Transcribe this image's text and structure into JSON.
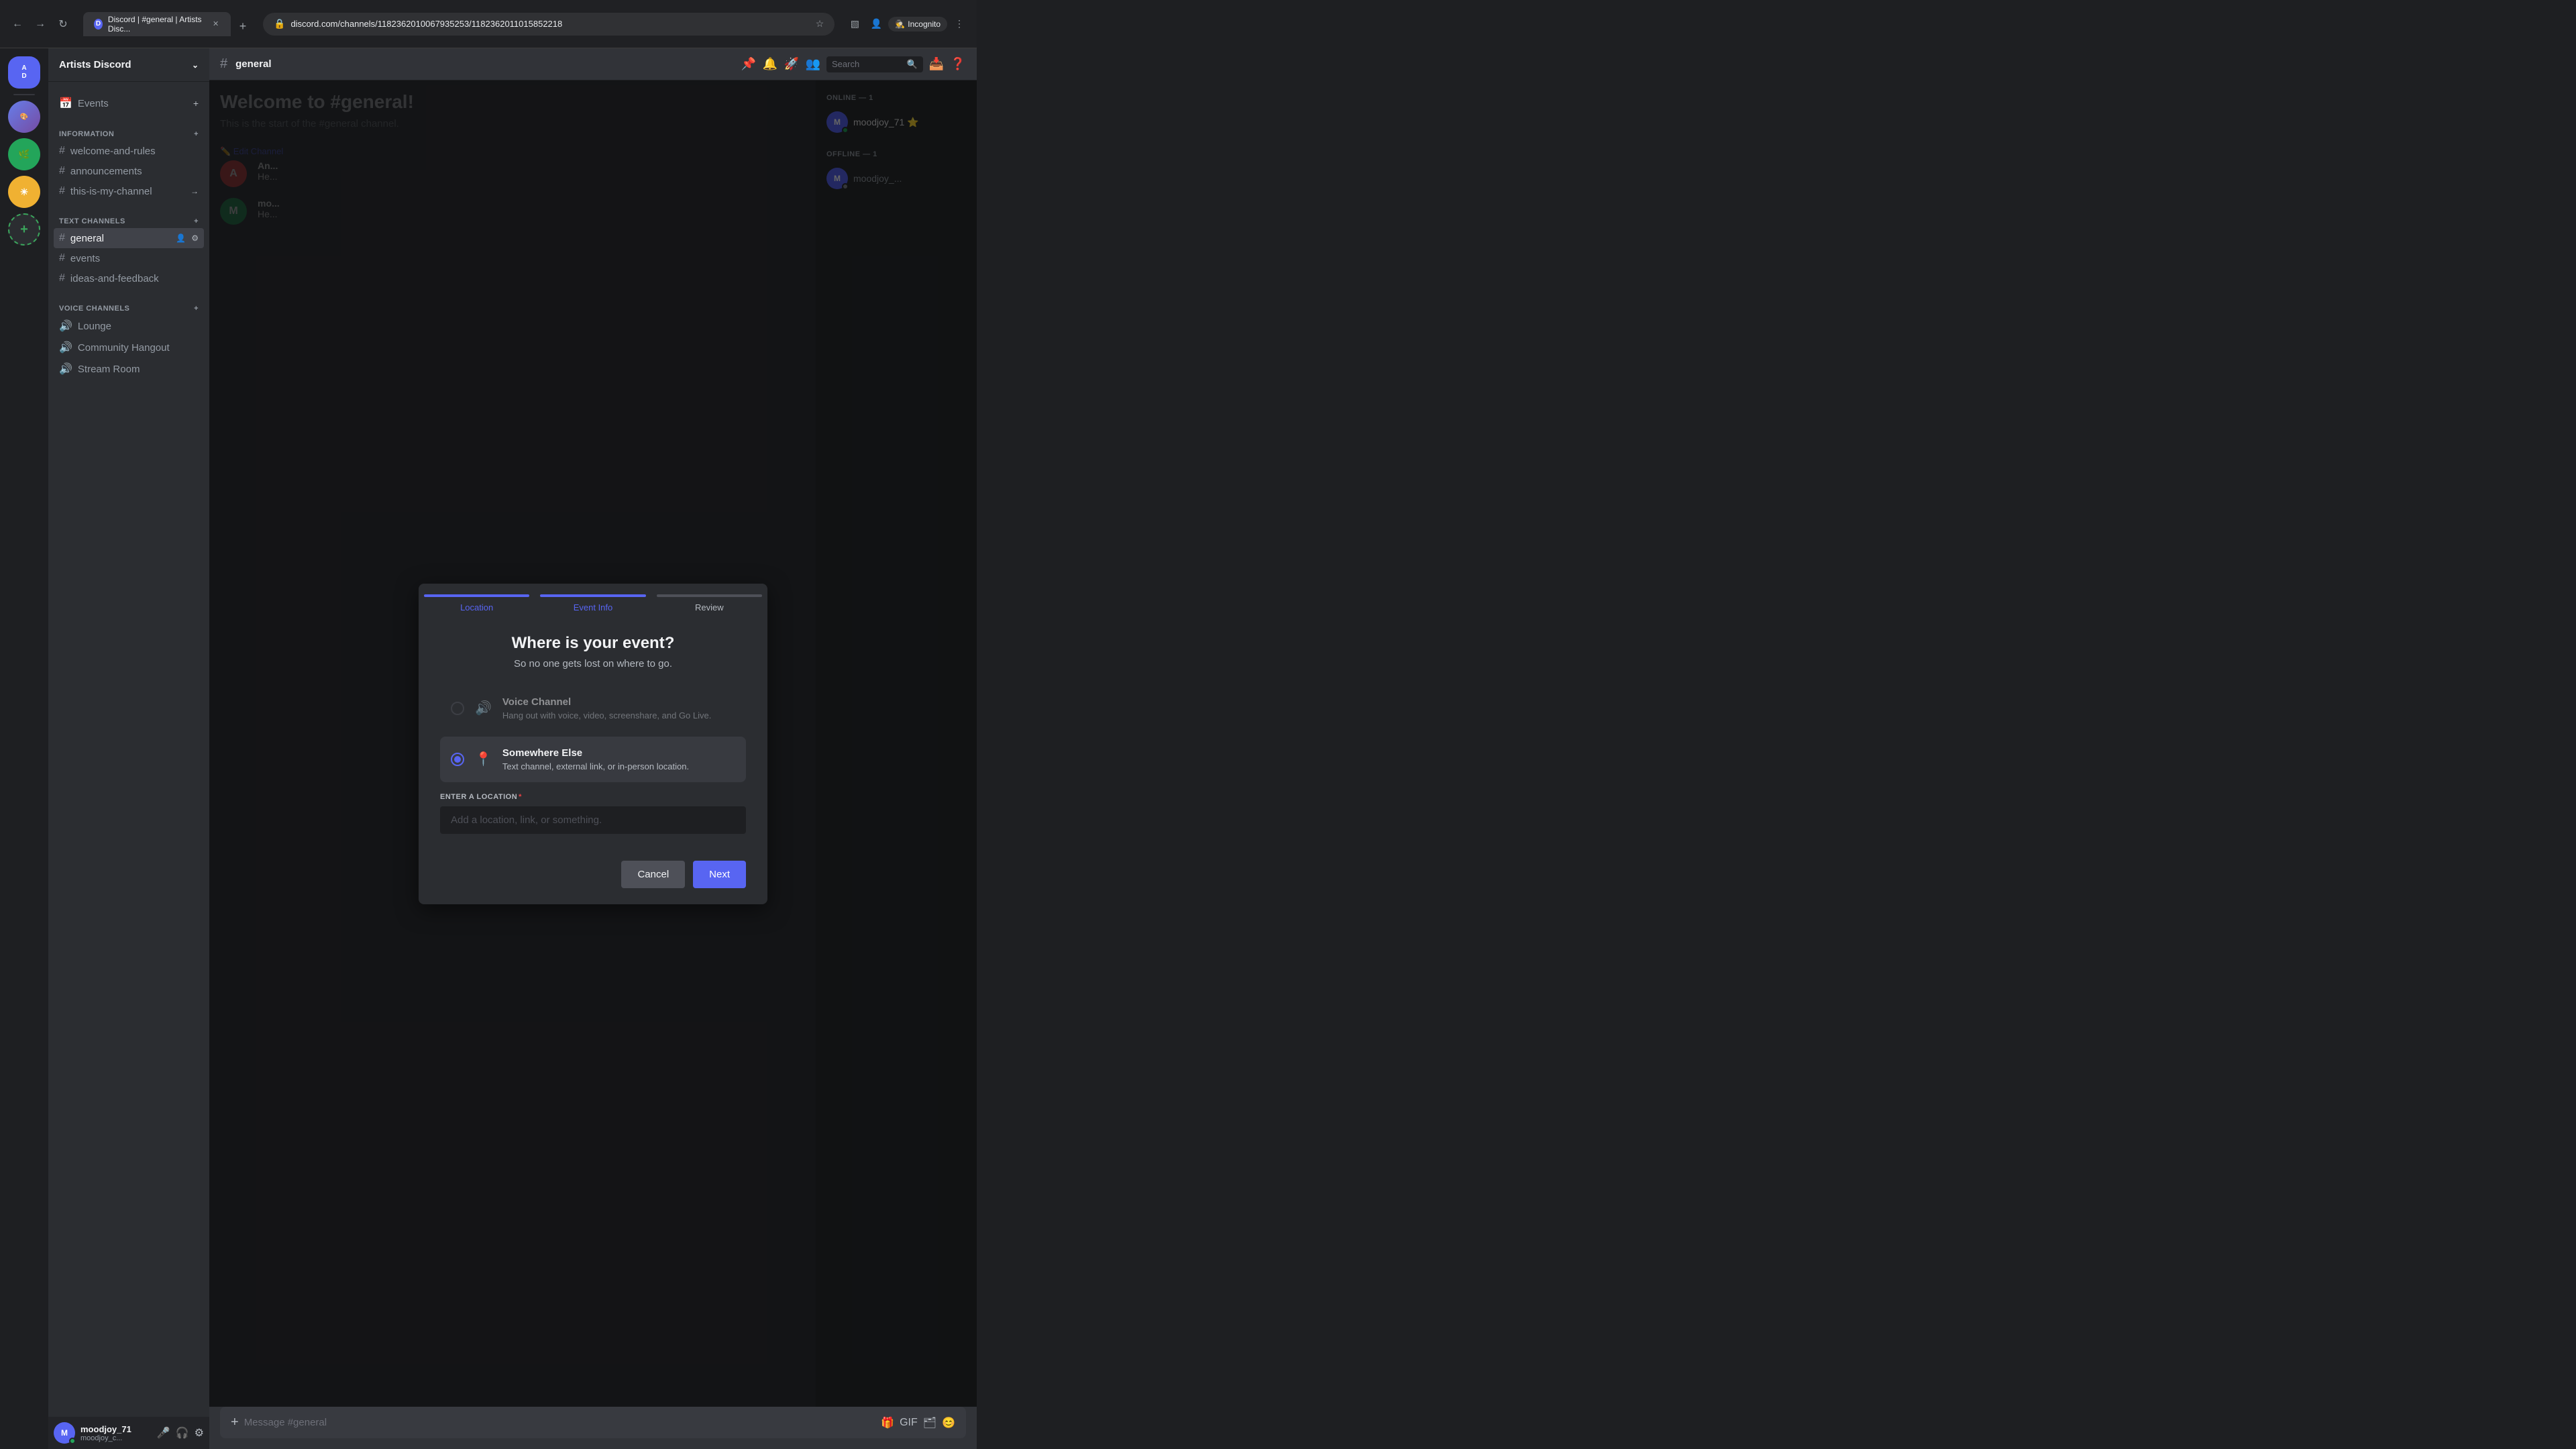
{
  "browser": {
    "tab_title": "Discord | #general | Artists Disc...",
    "tab_favicon": "D",
    "url": "discord.com/channels/1182362010067935253/1182362011015852218",
    "incognito_label": "Incognito"
  },
  "discord": {
    "server_name": "Artists Discord",
    "channel_name": "general",
    "search_placeholder": "Search"
  },
  "sidebar": {
    "information_section": "INFORMATION",
    "text_channels_section": "TEXT CHANNELS",
    "voice_channels_section": "VOICE CHANNELS",
    "channels": [
      {
        "name": "Events",
        "type": "event",
        "icon": "📅"
      },
      {
        "name": "welcome-and-rules",
        "type": "text"
      },
      {
        "name": "announcements",
        "type": "text"
      },
      {
        "name": "this-is-my-channel",
        "type": "text"
      },
      {
        "name": "general",
        "type": "text",
        "active": true
      },
      {
        "name": "events",
        "type": "text"
      },
      {
        "name": "ideas-and-feedback",
        "type": "text"
      },
      {
        "name": "Lounge",
        "type": "voice"
      },
      {
        "name": "Community Hangout",
        "type": "voice"
      },
      {
        "name": "Stream Room",
        "type": "voice"
      }
    ]
  },
  "main": {
    "welcome_title": "Welcome to #general!",
    "welcome_sub": "This is the start of the #general channel."
  },
  "right_sidebar": {
    "online_label": "ONLINE — 1",
    "offline_label": "OFFLINE — 1",
    "members": [
      {
        "name": "moodjoy_71",
        "status": "online",
        "badge": "⭐"
      },
      {
        "name": "moodjoy_...",
        "status": "offline"
      }
    ]
  },
  "user_area": {
    "username": "moodjoy_71",
    "tag": "moodjoy_c..."
  },
  "modal": {
    "steps": [
      {
        "label": "Location",
        "state": "active"
      },
      {
        "label": "Event Info",
        "state": "active"
      },
      {
        "label": "Review",
        "state": "inactive"
      }
    ],
    "title": "Where is your event?",
    "subtitle": "So no one gets lost on where to go.",
    "options": [
      {
        "id": "voice_channel",
        "title": "Voice Channel",
        "description": "Hang out with voice, video, screenshare, and Go Live.",
        "selected": false
      },
      {
        "id": "somewhere_else",
        "title": "Somewhere Else",
        "description": "Text channel, external link, or in-person location.",
        "selected": true
      }
    ],
    "location_label": "ENTER A LOCATION",
    "location_placeholder": "Add a location, link, or something.",
    "cancel_label": "Cancel",
    "next_label": "Next"
  }
}
